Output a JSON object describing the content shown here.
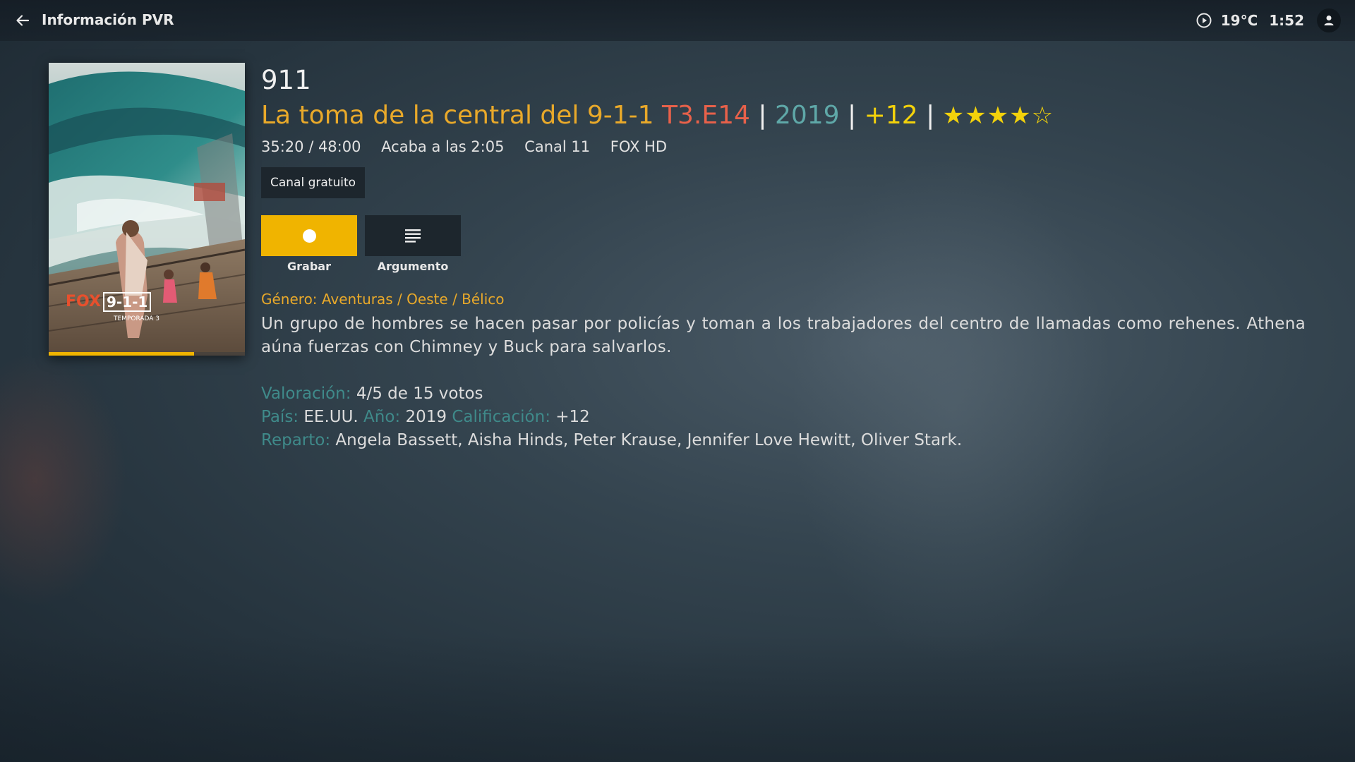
{
  "header": {
    "title": "Información PVR",
    "temperature": "19°C",
    "time": "1:52"
  },
  "poster": {
    "progress": 0.74,
    "art_labels": [
      "FOX",
      "9-1-1",
      "TEMPORADA 3"
    ]
  },
  "program": {
    "show_title": "911",
    "episode_title": "La toma de la central del 9-1-1",
    "episode_code": "T3.E14",
    "separator": "|",
    "year": "2019",
    "age_rating": "+12",
    "stars": "★★★★☆",
    "star_value": 4,
    "star_max": 5
  },
  "meta": {
    "elapsed": "35:20 / 48:00",
    "ends_at": "Acaba a las 2:05",
    "channel_number": "Canal 11",
    "channel_name": "FOX HD"
  },
  "badge": {
    "label": "Canal gratuito"
  },
  "actions": {
    "record_label": "Grabar",
    "plot_label": "Argumento"
  },
  "genre": "Género: Aventuras / Oeste / Bélico",
  "plot": "Un grupo de hombres se hacen pasar por policías y toman a los trabajadores del centro de llamadas como rehenes. Athena aúna fuerzas con Chimney y Buck para salvarlos.",
  "details": {
    "rating_label": "Valoración:",
    "rating_value": "4/5 de 15 votos",
    "country_label": "País:",
    "country_value": "EE.UU.",
    "year_label": "Año:",
    "year_value": "2019",
    "classification_label": "Calificación:",
    "classification_value": "+12",
    "cast_label": "Reparto:",
    "cast_value": "Angela Bassett, Aisha Hinds, Peter Krause, Jennifer Love Hewitt, Oliver Stark."
  },
  "colors": {
    "accent": "#f0b400",
    "episode_title": "#e9a92a",
    "episode_code": "#e8614a",
    "year": "#5fa8a8",
    "age_rating": "#f3d20b",
    "label_teal": "#3f8a8a",
    "button_dark": "#1d262d"
  },
  "icons": {
    "back": "arrow-left-icon",
    "clock": "clock-play-icon",
    "user": "user-icon",
    "record": "record-dot-icon",
    "plot": "text-lines-icon"
  }
}
